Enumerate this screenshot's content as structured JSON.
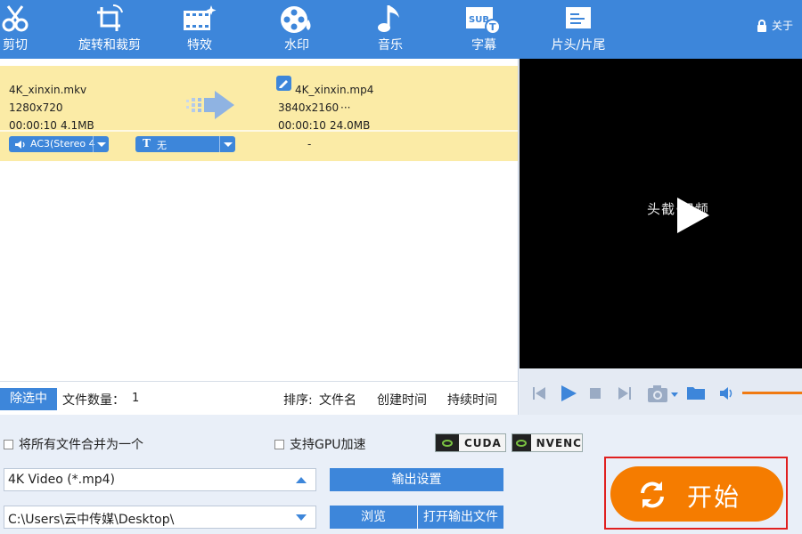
{
  "toolbar": {
    "items": [
      {
        "label": "剪切",
        "icon": "scissors-icon"
      },
      {
        "label": "旋转和裁剪",
        "icon": "crop-rotate-icon"
      },
      {
        "label": "特效",
        "icon": "film-effects-icon"
      },
      {
        "label": "水印",
        "icon": "film-reel-watermark-icon"
      },
      {
        "label": "音乐",
        "icon": "music-note-icon"
      },
      {
        "label": "字幕",
        "icon": "subtitle-icon"
      },
      {
        "label": "片头/片尾",
        "icon": "intro-outro-icon"
      }
    ],
    "about_label": "关于"
  },
  "file": {
    "source_name": "4K_xinxin.mkv",
    "source_resolution": "1280x720",
    "source_duration": "00:00:10",
    "source_size": "4.1MB",
    "output_name": "4K_xinxin.mp4",
    "output_resolution": "3840x2160",
    "output_more": "···",
    "output_duration": "00:00:10",
    "output_size": "24.0MB",
    "audio_track": "AC3(Stereo 4",
    "subtitle_track": "无",
    "extra": "-"
  },
  "list_bar": {
    "remove_selected": "除选中",
    "file_count_label": "文件数量：",
    "file_count": "1",
    "sort_label": "排序:",
    "sort_by_name": "文件名",
    "sort_by_created": "创建时间",
    "sort_by_duration": "持续时间"
  },
  "preview": {
    "watermark_text": "头截·识频"
  },
  "bottom": {
    "merge_label": "将所有文件合并为一个",
    "gpu_label": "支持GPU加速",
    "cuda_label": "CUDA",
    "nvenc_label": "NVENC",
    "format_value": "4K Video (*.mp4)",
    "output_settings_label": "输出设置",
    "path_value": "C:\\Users\\云中传媒\\Desktop\\",
    "browse_label": "浏览",
    "open_output_label": "打开输出文件",
    "start_label": "开始"
  },
  "colors": {
    "toolbar_bg": "#3d86da",
    "row_highlight": "#fbeba6",
    "start_button": "#f57c00",
    "highlight_frame": "#e02020"
  }
}
